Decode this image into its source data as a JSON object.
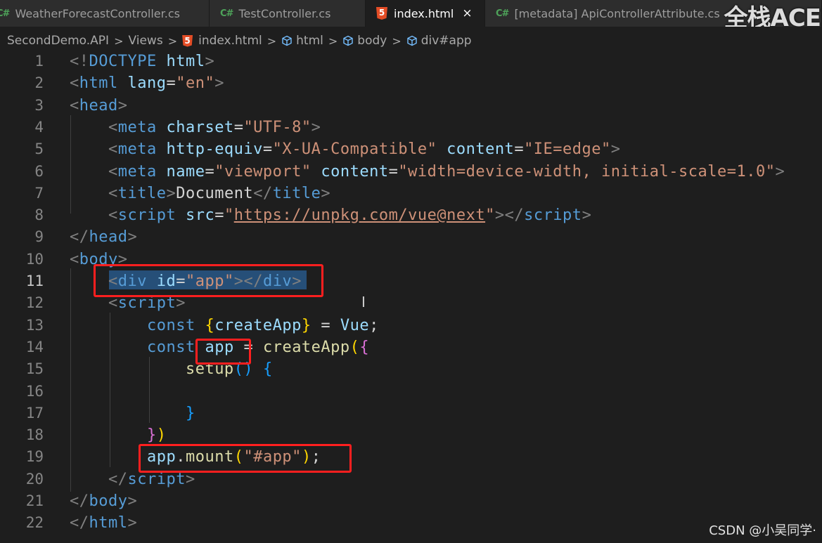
{
  "tabs": [
    {
      "name": "WeatherForecastController.cs",
      "icon": "csharp-icon",
      "icon_text": "C#"
    },
    {
      "name": "TestController.cs",
      "icon": "csharp-icon",
      "icon_text": "C#"
    },
    {
      "name": "index.html",
      "icon": "html5-icon",
      "close": "×",
      "active": true
    },
    {
      "name": "[metadata] ApiControllerAttribute.cs",
      "icon": "csharp-icon",
      "icon_text": "C#"
    }
  ],
  "watermark_top": "全栈ACE",
  "breadcrumb": {
    "project": "SecondDemo.API",
    "folder": "Views",
    "file": "index.html",
    "html": "html",
    "body": "body",
    "app": "div#app",
    "separator": ">"
  },
  "editor": {
    "current_line": 11,
    "line_numbers": [
      "1",
      "2",
      "3",
      "4",
      "5",
      "6",
      "7",
      "8",
      "9",
      "10",
      "11",
      "12",
      "13",
      "14",
      "15",
      "16",
      "17",
      "18",
      "19",
      "20",
      "21",
      "22"
    ],
    "lines": [
      [
        {
          "t": "<!",
          "c": "t-pun"
        },
        {
          "t": "DOCTYPE",
          "c": "t-tag"
        },
        {
          "t": " html",
          "c": "t-attr"
        },
        {
          "t": ">",
          "c": "t-pun"
        }
      ],
      [
        {
          "t": "<",
          "c": "t-pun"
        },
        {
          "t": "html",
          "c": "t-tag"
        },
        {
          "t": " lang",
          "c": "t-attr"
        },
        {
          "t": "=",
          "c": "t-txt"
        },
        {
          "t": "\"en\"",
          "c": "t-str"
        },
        {
          "t": ">",
          "c": "t-pun"
        }
      ],
      [
        {
          "t": "<",
          "c": "t-pun"
        },
        {
          "t": "head",
          "c": "t-tag"
        },
        {
          "t": ">",
          "c": "t-pun"
        }
      ],
      [
        {
          "t": "    ",
          "c": "t-txt"
        },
        {
          "t": "<",
          "c": "t-pun"
        },
        {
          "t": "meta",
          "c": "t-tag"
        },
        {
          "t": " charset",
          "c": "t-attr"
        },
        {
          "t": "=",
          "c": "t-txt"
        },
        {
          "t": "\"UTF-8\"",
          "c": "t-str"
        },
        {
          "t": ">",
          "c": "t-pun"
        }
      ],
      [
        {
          "t": "    ",
          "c": "t-txt"
        },
        {
          "t": "<",
          "c": "t-pun"
        },
        {
          "t": "meta",
          "c": "t-tag"
        },
        {
          "t": " http-equiv",
          "c": "t-attr"
        },
        {
          "t": "=",
          "c": "t-txt"
        },
        {
          "t": "\"X-UA-Compatible\"",
          "c": "t-str"
        },
        {
          "t": " content",
          "c": "t-attr"
        },
        {
          "t": "=",
          "c": "t-txt"
        },
        {
          "t": "\"IE=edge\"",
          "c": "t-str"
        },
        {
          "t": ">",
          "c": "t-pun"
        }
      ],
      [
        {
          "t": "    ",
          "c": "t-txt"
        },
        {
          "t": "<",
          "c": "t-pun"
        },
        {
          "t": "meta",
          "c": "t-tag"
        },
        {
          "t": " name",
          "c": "t-attr"
        },
        {
          "t": "=",
          "c": "t-txt"
        },
        {
          "t": "\"viewport\"",
          "c": "t-str"
        },
        {
          "t": " content",
          "c": "t-attr"
        },
        {
          "t": "=",
          "c": "t-txt"
        },
        {
          "t": "\"width=device-width, initial-scale=1.0\"",
          "c": "t-str"
        },
        {
          "t": ">",
          "c": "t-pun"
        }
      ],
      [
        {
          "t": "    ",
          "c": "t-txt"
        },
        {
          "t": "<",
          "c": "t-pun"
        },
        {
          "t": "title",
          "c": "t-tag"
        },
        {
          "t": ">",
          "c": "t-pun"
        },
        {
          "t": "Document",
          "c": "t-txt"
        },
        {
          "t": "</",
          "c": "t-pun"
        },
        {
          "t": "title",
          "c": "t-tag"
        },
        {
          "t": ">",
          "c": "t-pun"
        }
      ],
      [
        {
          "t": "    ",
          "c": "t-txt"
        },
        {
          "t": "<",
          "c": "t-pun"
        },
        {
          "t": "script",
          "c": "t-tag"
        },
        {
          "t": " src",
          "c": "t-attr"
        },
        {
          "t": "=",
          "c": "t-txt"
        },
        {
          "t": "\"",
          "c": "t-str"
        },
        {
          "t": "https://unpkg.com/vue@next",
          "c": "t-url"
        },
        {
          "t": "\"",
          "c": "t-str"
        },
        {
          "t": "></",
          "c": "t-pun"
        },
        {
          "t": "script",
          "c": "t-tag"
        },
        {
          "t": ">",
          "c": "t-pun"
        }
      ],
      [
        {
          "t": "</",
          "c": "t-pun"
        },
        {
          "t": "head",
          "c": "t-tag"
        },
        {
          "t": ">",
          "c": "t-pun"
        }
      ],
      [
        {
          "t": "<",
          "c": "t-pun"
        },
        {
          "t": "body",
          "c": "t-tag"
        },
        {
          "t": ">",
          "c": "t-pun"
        }
      ],
      [
        {
          "t": "    ",
          "c": "t-txt"
        },
        {
          "t": "<",
          "c": "t-pun"
        },
        {
          "t": "div",
          "c": "t-tag"
        },
        {
          "t": " id",
          "c": "t-attr"
        },
        {
          "t": "=",
          "c": "t-txt"
        },
        {
          "t": "\"app\"",
          "c": "t-str"
        },
        {
          "t": "></",
          "c": "t-pun"
        },
        {
          "t": "div",
          "c": "t-tag"
        },
        {
          "t": ">",
          "c": "t-pun"
        }
      ],
      [
        {
          "t": "    ",
          "c": "t-txt"
        },
        {
          "t": "<",
          "c": "t-pun"
        },
        {
          "t": "script",
          "c": "t-tag"
        },
        {
          "t": ">",
          "c": "t-pun"
        }
      ],
      [
        {
          "t": "        ",
          "c": "t-txt"
        },
        {
          "t": "const",
          "c": "t-kw"
        },
        {
          "t": " ",
          "c": "t-txt"
        },
        {
          "t": "{",
          "c": "t-b1"
        },
        {
          "t": "createApp",
          "c": "t-var"
        },
        {
          "t": "}",
          "c": "t-b1"
        },
        {
          "t": " = ",
          "c": "t-txt"
        },
        {
          "t": "Vue",
          "c": "t-var"
        },
        {
          "t": ";",
          "c": "t-txt"
        }
      ],
      [
        {
          "t": "        ",
          "c": "t-txt"
        },
        {
          "t": "const",
          "c": "t-kw"
        },
        {
          "t": " ",
          "c": "t-txt"
        },
        {
          "t": "app",
          "c": "t-var"
        },
        {
          "t": " = ",
          "c": "t-txt"
        },
        {
          "t": "createApp",
          "c": "t-fn"
        },
        {
          "t": "(",
          "c": "t-b1"
        },
        {
          "t": "{",
          "c": "t-b2"
        }
      ],
      [
        {
          "t": "            ",
          "c": "t-txt"
        },
        {
          "t": "setup",
          "c": "t-fn"
        },
        {
          "t": "()",
          "c": "t-b3"
        },
        {
          "t": " ",
          "c": "t-txt"
        },
        {
          "t": "{",
          "c": "t-b3"
        }
      ],
      [
        {
          "t": "",
          "c": "t-txt"
        }
      ],
      [
        {
          "t": "            ",
          "c": "t-txt"
        },
        {
          "t": "}",
          "c": "t-b3"
        }
      ],
      [
        {
          "t": "        ",
          "c": "t-txt"
        },
        {
          "t": "}",
          "c": "t-b2"
        },
        {
          "t": ")",
          "c": "t-b1"
        }
      ],
      [
        {
          "t": "        ",
          "c": "t-txt"
        },
        {
          "t": "app",
          "c": "t-var"
        },
        {
          "t": ".",
          "c": "t-txt"
        },
        {
          "t": "mount",
          "c": "t-fn"
        },
        {
          "t": "(",
          "c": "t-b1"
        },
        {
          "t": "\"#app\"",
          "c": "t-str"
        },
        {
          "t": ")",
          "c": "t-b1"
        },
        {
          "t": ";",
          "c": "t-txt"
        }
      ],
      [
        {
          "t": "    ",
          "c": "t-txt"
        },
        {
          "t": "</",
          "c": "t-pun"
        },
        {
          "t": "script",
          "c": "t-tag"
        },
        {
          "t": ">",
          "c": "t-pun"
        }
      ],
      [
        {
          "t": "</",
          "c": "t-pun"
        },
        {
          "t": "body",
          "c": "t-tag"
        },
        {
          "t": ">",
          "c": "t-pun"
        }
      ],
      [
        {
          "t": "</",
          "c": "t-pun"
        },
        {
          "t": "html",
          "c": "t-tag"
        },
        {
          "t": ">",
          "c": "t-pun"
        }
      ]
    ]
  },
  "colors": {
    "highlight_box": "#ff1f1f",
    "selection": "#264f78",
    "editor_bg": "#1e1e1e"
  },
  "watermark_bottom": "CSDN @小吴同学·"
}
